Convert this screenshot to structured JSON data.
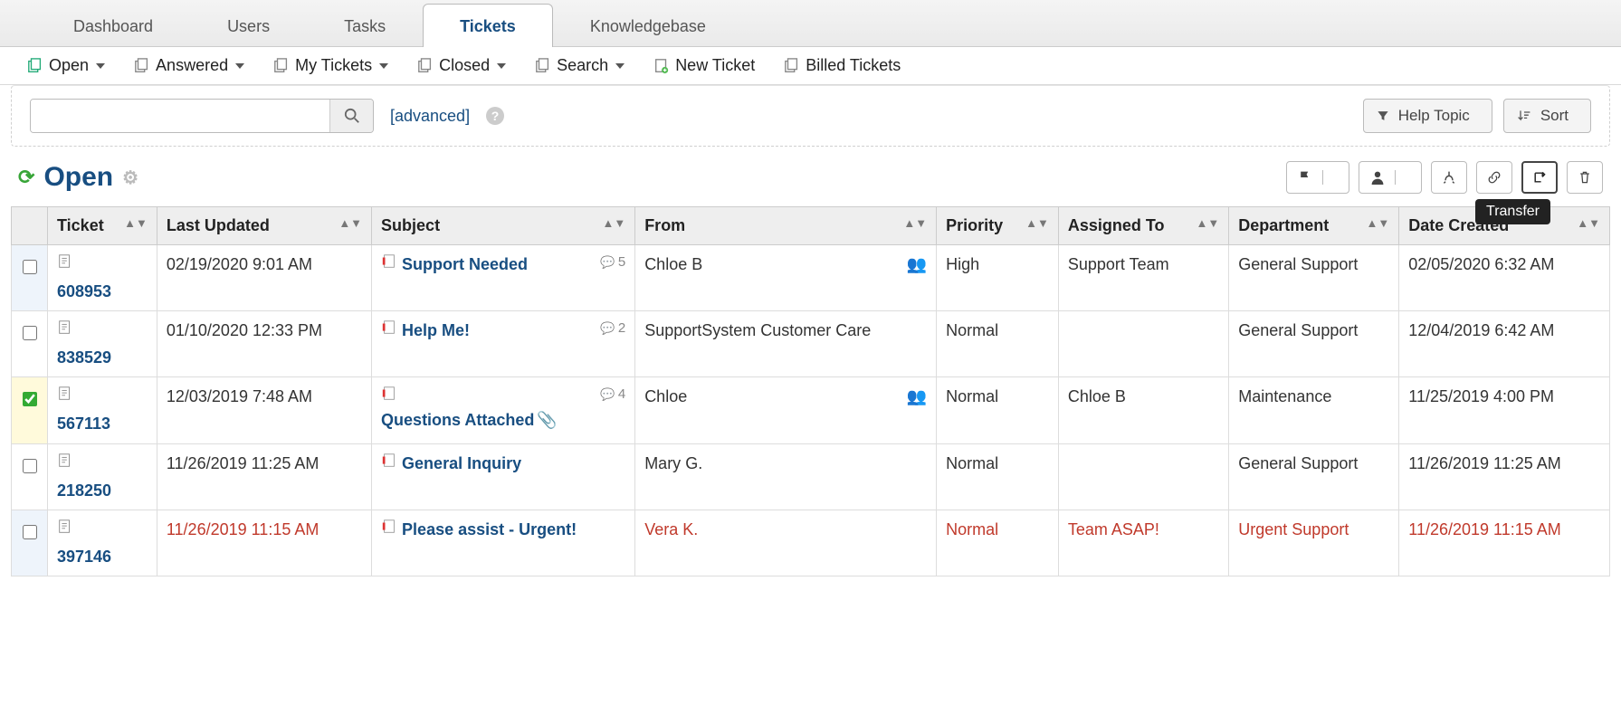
{
  "nav": {
    "tabs": [
      {
        "label": "Dashboard",
        "active": false
      },
      {
        "label": "Users",
        "active": false
      },
      {
        "label": "Tasks",
        "active": false
      },
      {
        "label": "Tickets",
        "active": true
      },
      {
        "label": "Knowledgebase",
        "active": false
      }
    ]
  },
  "subnav": {
    "open": "Open",
    "answered": "Answered",
    "my_tickets": "My Tickets",
    "closed": "Closed",
    "search": "Search",
    "new_ticket": "New Ticket",
    "billed": "Billed Tickets"
  },
  "filter": {
    "search_value": "",
    "search_placeholder": "",
    "advanced_label": "[advanced]",
    "help_topic_label": "Help Topic",
    "sort_label": "Sort"
  },
  "list": {
    "title": "Open",
    "tooltip": "Transfer"
  },
  "columns": {
    "ticket": "Ticket",
    "last_updated": "Last Updated",
    "subject": "Subject",
    "from": "From",
    "priority": "Priority",
    "assigned": "Assigned To",
    "department": "Department",
    "created": "Date Created"
  },
  "tickets": [
    {
      "id": "608953",
      "checked": false,
      "alt": true,
      "updated": "02/19/2020 9:01 AM",
      "subject": "Support Needed",
      "thread": "5",
      "attach": false,
      "from": "Chloe B",
      "group": true,
      "priority": "High",
      "assigned": "Support Team",
      "dept": "General Support",
      "created": "02/05/2020 6:32 AM",
      "overdue": false
    },
    {
      "id": "838529",
      "checked": false,
      "alt": false,
      "updated": "01/10/2020 12:33 PM",
      "subject": "Help Me!",
      "thread": "2",
      "attach": false,
      "from": "SupportSystem Customer Care",
      "group": false,
      "priority": "Normal",
      "assigned": "",
      "dept": "General Support",
      "created": "12/04/2019 6:42 AM",
      "overdue": false
    },
    {
      "id": "567113",
      "checked": true,
      "alt": false,
      "updated": "12/03/2019 7:48 AM",
      "subject": "Questions Attached",
      "thread": "4",
      "attach": true,
      "from": "Chloe",
      "group": true,
      "priority": "Normal",
      "assigned": "Chloe B",
      "dept": "Maintenance",
      "created": "11/25/2019 4:00 PM",
      "overdue": false
    },
    {
      "id": "218250",
      "checked": false,
      "alt": false,
      "updated": "11/26/2019 11:25 AM",
      "subject": "General Inquiry",
      "thread": "",
      "attach": false,
      "from": "Mary G.",
      "group": false,
      "priority": "Normal",
      "assigned": "",
      "dept": "General Support",
      "created": "11/26/2019 11:25 AM",
      "overdue": false
    },
    {
      "id": "397146",
      "checked": false,
      "alt": true,
      "updated": "11/26/2019 11:15 AM",
      "subject": "Please assist - Urgent!",
      "thread": "",
      "attach": false,
      "from": "Vera K.",
      "group": false,
      "priority": "Normal",
      "assigned": "Team ASAP!",
      "dept": "Urgent Support",
      "created": "11/26/2019 11:15 AM",
      "overdue": true
    }
  ]
}
